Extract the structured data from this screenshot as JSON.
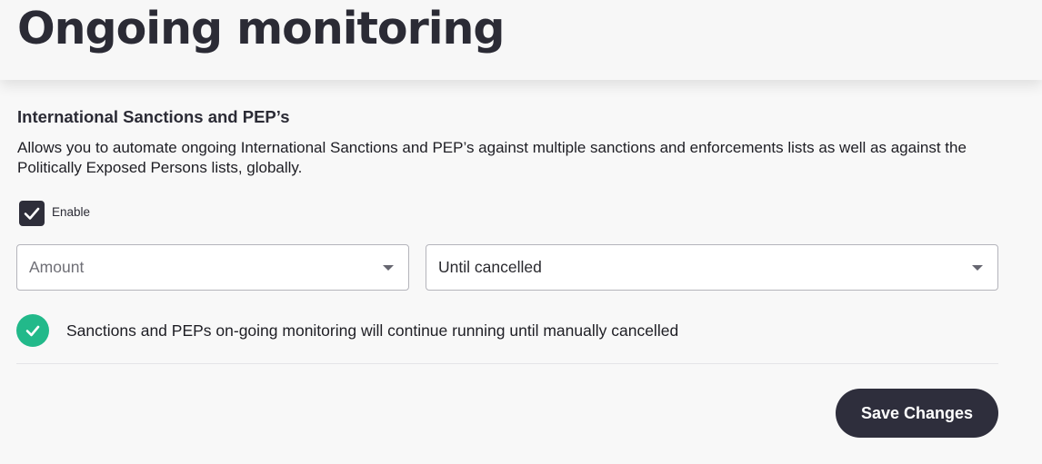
{
  "header": {
    "title": "Ongoing monitoring"
  },
  "section": {
    "title": "International Sanctions and PEP’s",
    "description": "Allows you to automate ongoing International Sanctions and PEP’s against multiple sanctions and enforcements lists as well as against the Politically Exposed Persons lists, globally."
  },
  "enable": {
    "label": "Enable",
    "checked": true,
    "icon": "checkmark-icon"
  },
  "amount_select": {
    "placeholder": "Amount",
    "icon": "chevron-down-icon"
  },
  "duration_select": {
    "value": "Until cancelled",
    "icon": "chevron-down-icon"
  },
  "status": {
    "icon": "check-circle-icon",
    "text": "Sanctions and PEPs on-going monitoring will continue running until manually cancelled",
    "color": "#22b98a"
  },
  "actions": {
    "save_label": "Save Changes"
  },
  "colors": {
    "primary_dark": "#2e2e3c",
    "success": "#22b98a",
    "background": "#f8f8f8"
  }
}
